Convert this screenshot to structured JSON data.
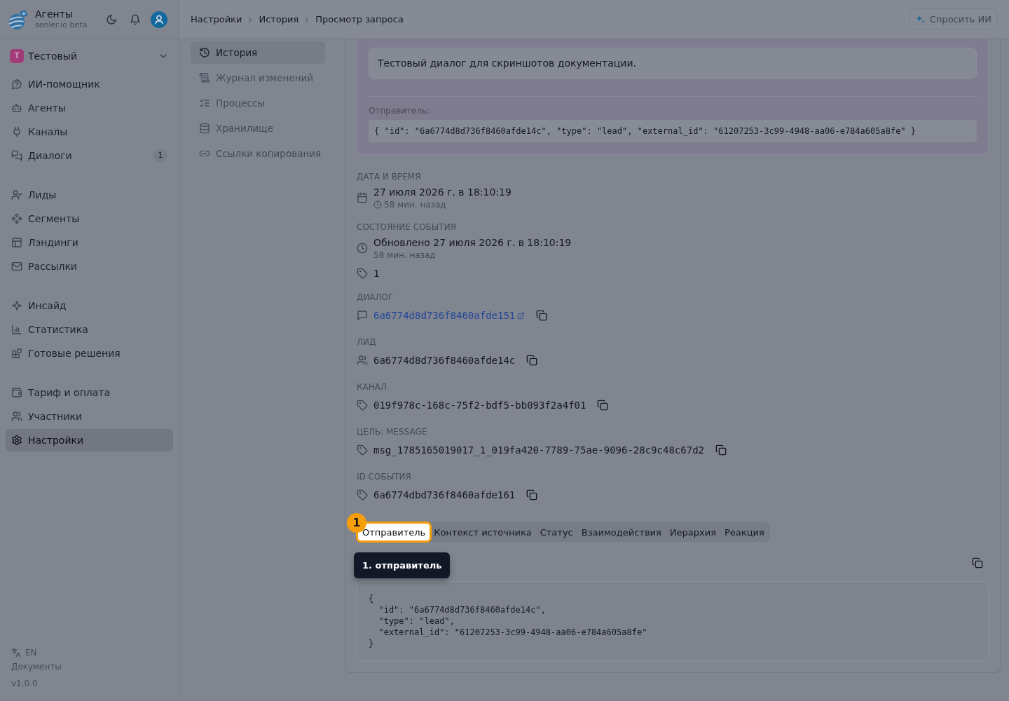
{
  "sidebar": {
    "brand": {
      "title": "Агенты",
      "subtitle": "senler.io beta"
    },
    "workspace": {
      "initial": "Т",
      "name": "Тестовый"
    },
    "groups": [
      {
        "items": [
          {
            "label": "ИИ-помощник",
            "selected": false
          },
          {
            "label": "Агенты",
            "selected": false
          },
          {
            "label": "Каналы",
            "selected": false
          },
          {
            "label": "Диалоги",
            "selected": false,
            "badge": "1"
          }
        ]
      },
      {
        "items": [
          {
            "label": "Лиды",
            "selected": false
          },
          {
            "label": "Сегменты",
            "selected": false
          },
          {
            "label": "Лэндинги",
            "selected": false
          },
          {
            "label": "Рассылки",
            "selected": false
          }
        ]
      },
      {
        "items": [
          {
            "label": "Инсайд",
            "selected": false
          },
          {
            "label": "Статистика",
            "selected": false
          },
          {
            "label": "Готовые решения",
            "selected": false
          }
        ]
      },
      {
        "items": [
          {
            "label": "Тариф и оплата",
            "selected": false
          },
          {
            "label": "Участники",
            "selected": false
          },
          {
            "label": "Настройки",
            "selected": true
          }
        ]
      }
    ],
    "footer": {
      "language": "EN",
      "docs": "Документы",
      "version": "v1.0.0"
    }
  },
  "header": {
    "breadcrumbs": [
      "Настройки",
      "История",
      "Просмотр запроса"
    ],
    "ask_button": "Спросить ИИ"
  },
  "subnav": {
    "items": [
      {
        "label": "История",
        "selected": true
      },
      {
        "label": "Журнал изменений",
        "selected": false
      },
      {
        "label": "Процессы",
        "selected": false
      },
      {
        "label": "Хранилище",
        "selected": false
      },
      {
        "label": "Ссылки копирования",
        "selected": false
      }
    ]
  },
  "event_card": {
    "message": "Тестовый диалог для скриншотов документации.",
    "sender_label": "Отправитель:",
    "sender_code": "{ \"id\": \"6a6774d8d736f8460afde14c\", \"type\": \"lead\", \"external_id\": \"61207253-3c99-4948-aa06-e784a605a8fe\" }"
  },
  "details": [
    {
      "kind": "date",
      "label": "ДАТА И ВРЕМЯ",
      "value": "27 июля 2026 г. в 18:10:19",
      "ago": "58 мин. назад"
    },
    {
      "kind": "status",
      "label": "СОСТОЯНИЕ СОБЫТИЯ",
      "value": "Обновлено 27 июля 2026 г. в 18:10:19",
      "ago": "58 мин. назад"
    },
    {
      "kind": "count",
      "value": "1"
    },
    {
      "kind": "link",
      "label": "ДИАЛОГ",
      "value": "6a6774d8d736f8460afde151"
    },
    {
      "kind": "lead",
      "label": "ЛИД",
      "value": "6a6774d8d736f8460afde14c"
    },
    {
      "kind": "id",
      "label": "КАНАЛ",
      "value": "019f978c-168c-75f2-bdf5-bb093f2a4f01"
    },
    {
      "kind": "id",
      "label": "ЦЕЛЬ: MESSAGE",
      "value": "msg_1785165019017_1_019fa420-7789-75ae-9096-28c9c48c67d2"
    },
    {
      "kind": "id",
      "label": "ID СОБЫТИЯ",
      "value": "6a6774dbd736f8460afde161"
    }
  ],
  "tabs": [
    {
      "label": "Отправитель",
      "selected": true,
      "highlighted": true
    },
    {
      "label": "Контекст источника",
      "selected": false,
      "highlighted": false
    },
    {
      "label": "Статус",
      "selected": false,
      "highlighted": false
    },
    {
      "label": "Взаимодействия",
      "selected": false,
      "highlighted": false
    },
    {
      "label": "Иерархия",
      "selected": false,
      "highlighted": false
    },
    {
      "label": "Реакция",
      "selected": false,
      "highlighted": false
    }
  ],
  "tab_content": {
    "code": "{\n  \"id\": \"6a6774d8d736f8460afde14c\",\n  \"type\": \"lead\",\n  \"external_id\": \"61207253-3c99-4948-aa06-e784a605a8fe\"\n}"
  },
  "tour": {
    "badge": "1",
    "tooltip": "1. отправитель"
  }
}
